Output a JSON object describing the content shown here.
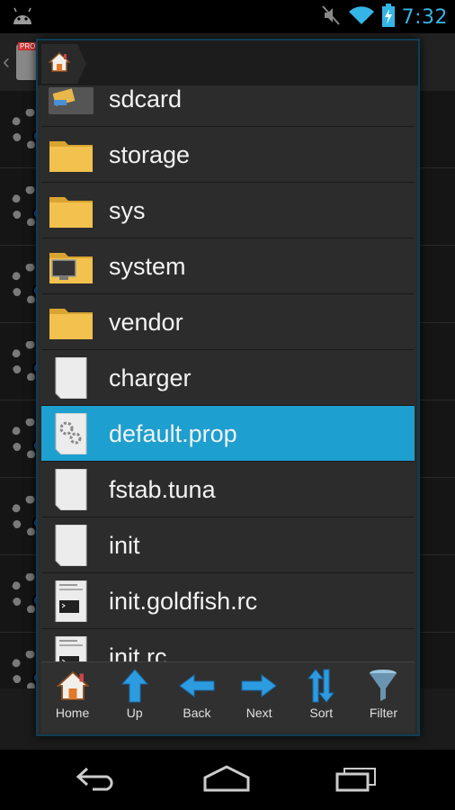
{
  "status_bar": {
    "time": "7:32",
    "icons": [
      "android-icon",
      "mute-icon",
      "wifi-icon",
      "battery-charging-icon"
    ]
  },
  "background_app": {
    "badge": "PROP"
  },
  "dialog": {
    "breadcrumb_icon": "home-icon",
    "files": [
      {
        "name": "sdcard",
        "type": "sdcard",
        "selected": false
      },
      {
        "name": "storage",
        "type": "folder",
        "selected": false
      },
      {
        "name": "sys",
        "type": "folder",
        "selected": false
      },
      {
        "name": "system",
        "type": "folder-system",
        "selected": false
      },
      {
        "name": "vendor",
        "type": "folder",
        "selected": false
      },
      {
        "name": "charger",
        "type": "file",
        "selected": false
      },
      {
        "name": "default.prop",
        "type": "file-settings",
        "selected": true
      },
      {
        "name": "fstab.tuna",
        "type": "file",
        "selected": false
      },
      {
        "name": "init",
        "type": "file",
        "selected": false
      },
      {
        "name": "init.goldfish.rc",
        "type": "file-script",
        "selected": false
      },
      {
        "name": "init.rc",
        "type": "file-script",
        "selected": false
      }
    ],
    "toolbar": [
      {
        "label": "Home",
        "icon": "home-icon"
      },
      {
        "label": "Up",
        "icon": "arrow-up-icon"
      },
      {
        "label": "Back",
        "icon": "arrow-left-icon"
      },
      {
        "label": "Next",
        "icon": "arrow-right-icon"
      },
      {
        "label": "Sort",
        "icon": "sort-icon"
      },
      {
        "label": "Filter",
        "icon": "filter-icon"
      }
    ]
  },
  "colors": {
    "accent": "#35b5e5",
    "selection": "#1d9fcf",
    "folder": "#f2c14e"
  },
  "nav_bar": {
    "buttons": [
      "back-icon",
      "home-icon",
      "recent-apps-icon"
    ]
  }
}
